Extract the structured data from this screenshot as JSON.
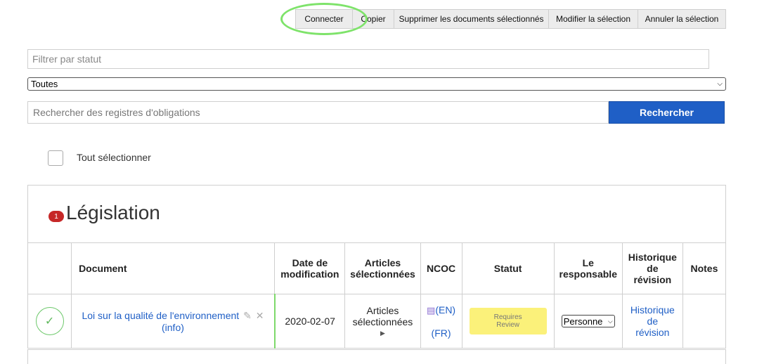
{
  "toolbar": {
    "buttons": [
      "Connecter",
      "Copier",
      "Supprimer les documents sélectionnés",
      "Modifier la sélection",
      "Annuler la sélection"
    ]
  },
  "filters": {
    "status_placeholder": "Filtrer par statut",
    "status_select_value": "Toutes",
    "search_placeholder": "Rechercher des registres d'obligations",
    "search_button": "Rechercher"
  },
  "select_all_label": "Tout sélectionner",
  "section": {
    "badge_count": "1",
    "title": "Législation"
  },
  "table": {
    "headers": {
      "document": "Document",
      "date_line1": "Date de",
      "date_line2": "modification",
      "articles_line1": "Articles",
      "articles_line2": "sélectionnées",
      "ncoc": "NCOC",
      "statut": "Statut",
      "resp_line1": "Le",
      "resp_line2": "responsable",
      "hist_line1": "Historique",
      "hist_line2": "de",
      "hist_line3": "révision",
      "notes": "Notes"
    },
    "rows": [
      {
        "document_title": "Loi sur la qualité de l'environnement",
        "document_info": "(info)",
        "date": "2020-02-07",
        "articles_line1": "Articles",
        "articles_line2": "sélectionnées",
        "ncoc_en": "(EN)",
        "ncoc_fr": "(FR)",
        "status_line1": "Requires",
        "status_line2": "Review",
        "responsible": "Personne",
        "history_line1": "Historique",
        "history_line2": "de",
        "history_line3": "révision",
        "notes": ""
      }
    ]
  },
  "colors": {
    "primary": "#1f5fc6",
    "status_yellow": "#fbf17a",
    "badge_red": "#c62828",
    "highlight_green": "#7ee36a"
  }
}
